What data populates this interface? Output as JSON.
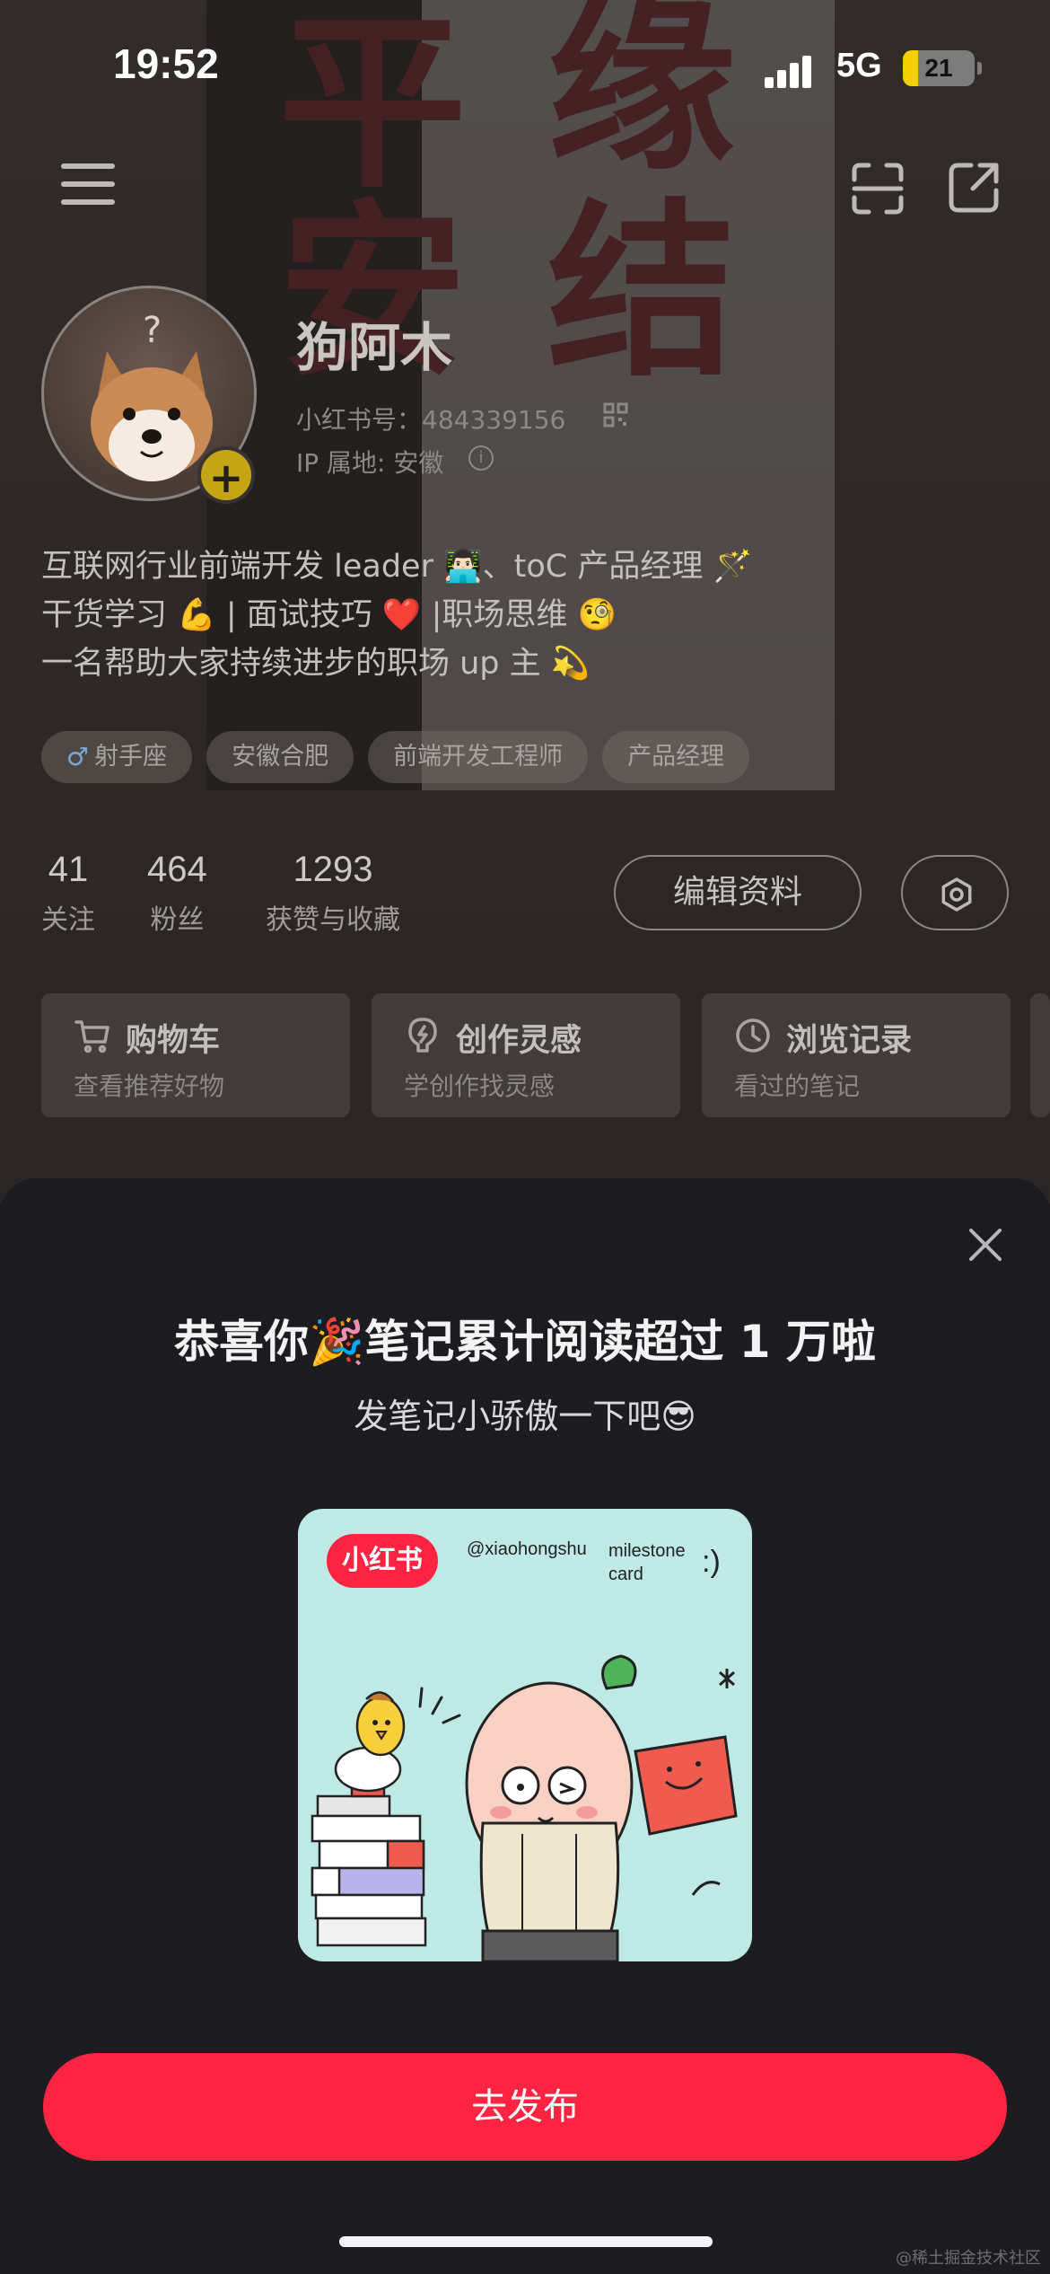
{
  "status_bar": {
    "time": "19:52",
    "network": "5G",
    "battery": "21",
    "battery_level": 0.21
  },
  "background": {
    "banner_chars": [
      "平",
      "缘",
      "安",
      "结"
    ]
  },
  "header": {
    "icons": [
      "menu-icon",
      "scan-icon",
      "share-icon"
    ]
  },
  "profile": {
    "avatar_badge": "?",
    "avatar_plus": "+",
    "nickname": "狗阿木",
    "redbook_id": "小红书号：484339156",
    "ip_location": "IP 属地: 安徽",
    "bio_lines": [
      "互联网行业前端开发 leader 👨🏻‍💻、toC 产品经理 🪄",
      "干货学习 💪 | 面试技巧 ❤️ |职场思维 🧐",
      "一名帮助大家持续进步的职场 up 主 💫"
    ],
    "tags": [
      "射手座",
      "安徽合肥",
      "前端开发工程师",
      "产品经理"
    ],
    "tag_icon": "♂"
  },
  "stats": [
    {
      "value": "41",
      "label": "关注"
    },
    {
      "value": "464",
      "label": "粉丝"
    },
    {
      "value": "1293",
      "label": "获赞与收藏"
    }
  ],
  "actions": {
    "edit_profile": "编辑资料"
  },
  "quick_cards": [
    {
      "title": "购物车",
      "subtitle": "查看推荐好物",
      "icon": "cart-icon"
    },
    {
      "title": "创作灵感",
      "subtitle": "学创作找灵感",
      "icon": "lightbulb-icon"
    },
    {
      "title": "浏览记录",
      "subtitle": "看过的笔记",
      "icon": "clock-icon"
    }
  ],
  "sheet": {
    "title": "恭喜你🎉笔记累计阅读超过 1 万啦",
    "subtitle": "发笔记小骄傲一下吧😎",
    "card": {
      "logo": "小红书",
      "handle": "@xiaohongshu",
      "milestone": "milestone",
      "card_word": "card",
      "smile": ":)"
    },
    "publish_button": "去发布"
  },
  "watermark": "@稀土掘金技术社区",
  "colors": {
    "brand_red": "#ff2442",
    "sheet_bg": "#1c1c21",
    "card_bg": "#bfe9e4"
  }
}
